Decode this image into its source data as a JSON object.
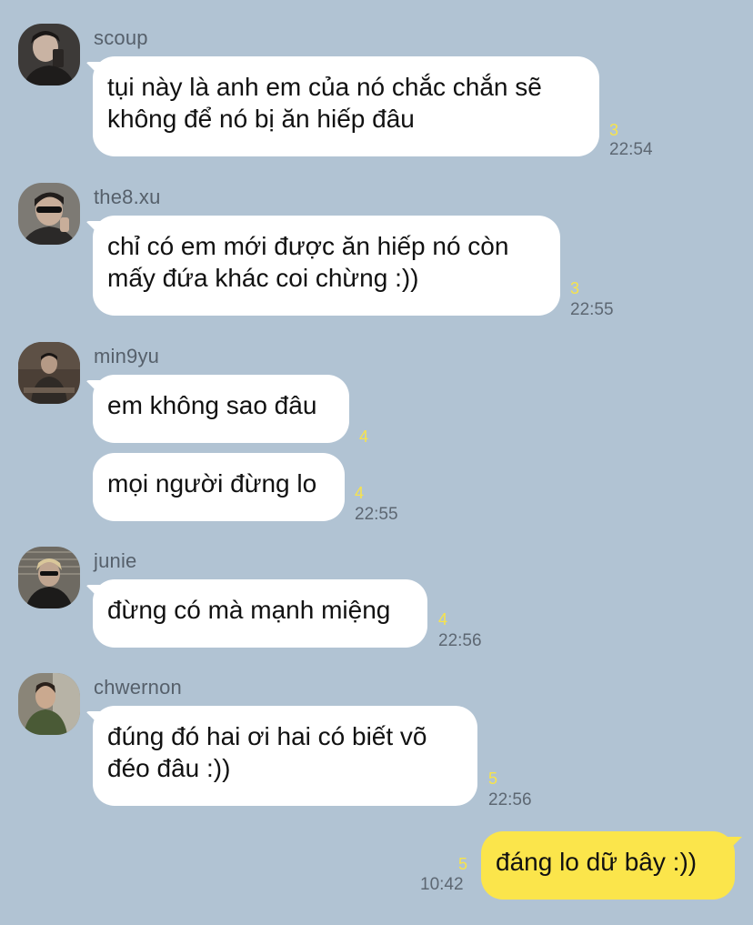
{
  "chat": {
    "messages": [
      {
        "sender": "scoup",
        "avatar": "avatar-scoup",
        "text": "tụi này là anh em của nó chắc chắn sẽ\nkhông để nó bị ăn hiếp đâu",
        "unread": "3",
        "time": "22:54"
      },
      {
        "sender": "the8.xu",
        "avatar": "avatar-the8",
        "text": "chỉ có em mới được ăn hiếp nó còn\nmấy đứa khác coi chừng :))",
        "unread": "3",
        "time": "22:55"
      },
      {
        "sender": "min9yu",
        "avatar": "avatar-min9yu",
        "text": "em không sao đâu",
        "unread": "4",
        "time": ""
      },
      {
        "sender": "",
        "avatar": "",
        "text": "mọi người đừng lo",
        "unread": "4",
        "time": "22:55"
      },
      {
        "sender": "junie",
        "avatar": "avatar-junie",
        "text": "đừng có mà mạnh miệng",
        "unread": "4",
        "time": "22:56"
      },
      {
        "sender": "chwernon",
        "avatar": "avatar-chwernon",
        "text": "đúng đó hai ơi hai có biết võ\nđéo đâu :))",
        "unread": "5",
        "time": "22:56"
      },
      {
        "sender": "me",
        "avatar": "",
        "text": "đáng lo dữ bây :))",
        "unread": "5",
        "time": "10:42"
      }
    ]
  },
  "colors": {
    "background": "#b1c3d3",
    "bubble_other": "#ffffff",
    "bubble_mine": "#fbe54b",
    "unread_count": "#f7e34b",
    "timestamp": "#5d6772"
  }
}
